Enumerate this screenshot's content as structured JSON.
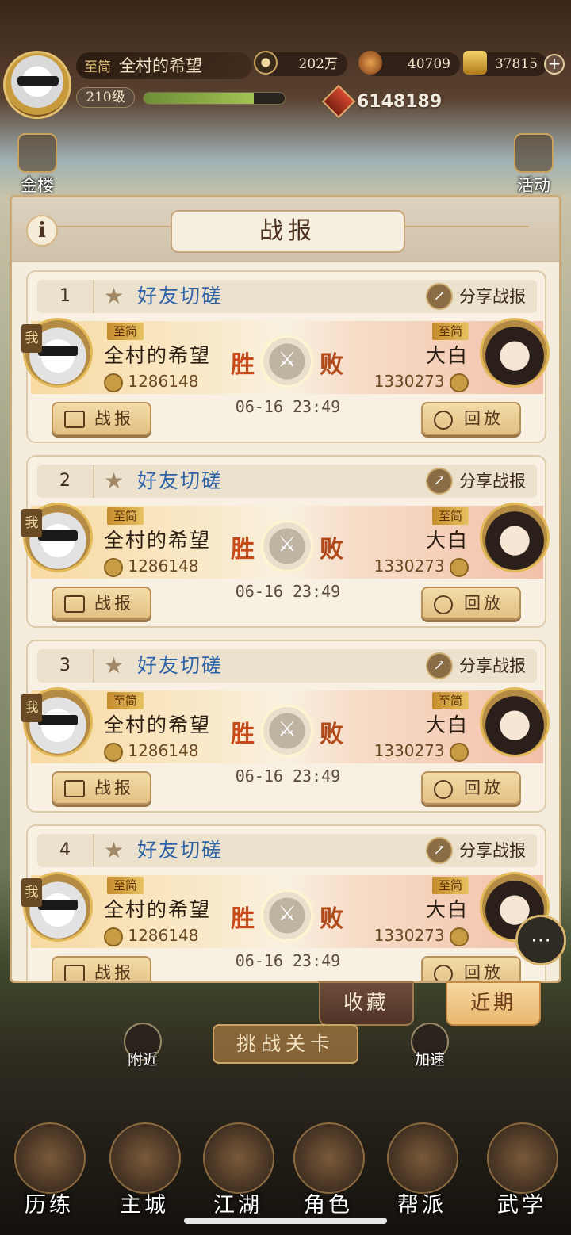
{
  "player": {
    "vip": "至简",
    "name": "全村的希望",
    "level": "210级",
    "xp_fraction": 0.78
  },
  "resources": {
    "silver": "202万",
    "gem_a": "40709",
    "gold": "37815",
    "power": "6148189"
  },
  "side": {
    "left_label": "金楼",
    "right_label": "活动"
  },
  "panel": {
    "title": "战报",
    "info": "i"
  },
  "battles": [
    {
      "index": "1",
      "type": "好友切磋",
      "share": "分享战报",
      "me_tag": "我",
      "vip": "至简",
      "left_name": "全村的希望",
      "left_power": "1286148",
      "win": "胜",
      "lose": "败",
      "right_vip": "至简",
      "right_name": "大白",
      "right_power": "1330273",
      "time": "06-16 23:49",
      "report": "战报",
      "replay": "回放"
    },
    {
      "index": "2",
      "type": "好友切磋",
      "share": "分享战报",
      "me_tag": "我",
      "vip": "至简",
      "left_name": "全村的希望",
      "left_power": "1286148",
      "win": "胜",
      "lose": "败",
      "right_vip": "至简",
      "right_name": "大白",
      "right_power": "1330273",
      "time": "06-16 23:49",
      "report": "战报",
      "replay": "回放"
    },
    {
      "index": "3",
      "type": "好友切磋",
      "share": "分享战报",
      "me_tag": "我",
      "vip": "至简",
      "left_name": "全村的希望",
      "left_power": "1286148",
      "win": "胜",
      "lose": "败",
      "right_vip": "至简",
      "right_name": "大白",
      "right_power": "1330273",
      "time": "06-16 23:49",
      "report": "战报",
      "replay": "回放"
    },
    {
      "index": "4",
      "type": "好友切磋",
      "share": "分享战报",
      "me_tag": "我",
      "vip": "至简",
      "left_name": "全村的希望",
      "left_power": "1286148",
      "win": "胜",
      "lose": "败",
      "right_vip": "至简",
      "right_name": "大白",
      "right_power": "1330273",
      "time": "06-16 23:49",
      "report": "战报",
      "replay": "回放"
    }
  ],
  "tabs": {
    "favorites": "收藏",
    "recent": "近期"
  },
  "actions": {
    "nearby": "附近",
    "challenge": "挑战关卡",
    "speed": "加速"
  },
  "nav": [
    "历练",
    "主城",
    "江湖",
    "角色",
    "帮派",
    "武学"
  ],
  "colors": {
    "battle_type": "#2f63a8",
    "win": "#c84a1a",
    "panel_bg": "#f4ecdc"
  }
}
